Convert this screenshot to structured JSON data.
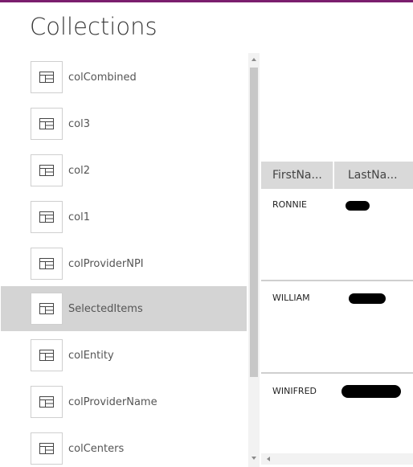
{
  "title": "Collections",
  "collections": [
    {
      "label": "colCombined",
      "icon": "table-icon"
    },
    {
      "label": "col3",
      "icon": "table-icon"
    },
    {
      "label": "col2",
      "icon": "table-icon"
    },
    {
      "label": "col1",
      "icon": "table-icon"
    },
    {
      "label": "colProviderNPI",
      "icon": "table-icon"
    },
    {
      "label": "SelectedItems",
      "icon": "table-icon",
      "selected": true
    },
    {
      "label": "colEntity",
      "icon": "table-icon"
    },
    {
      "label": "colProviderName",
      "icon": "table-icon"
    },
    {
      "label": "colCenters",
      "icon": "table-icon"
    }
  ],
  "grid": {
    "columns": [
      "FirstNa...",
      "LastNa..."
    ],
    "rows": [
      {
        "first": "RONNIE"
      },
      {
        "first": "WILLIAM"
      },
      {
        "first": "WINIFRED"
      }
    ]
  },
  "colors": {
    "accent": "#7b1e6e",
    "selected_bg": "#d4d4d4",
    "header_bg": "#d9d9d9"
  }
}
